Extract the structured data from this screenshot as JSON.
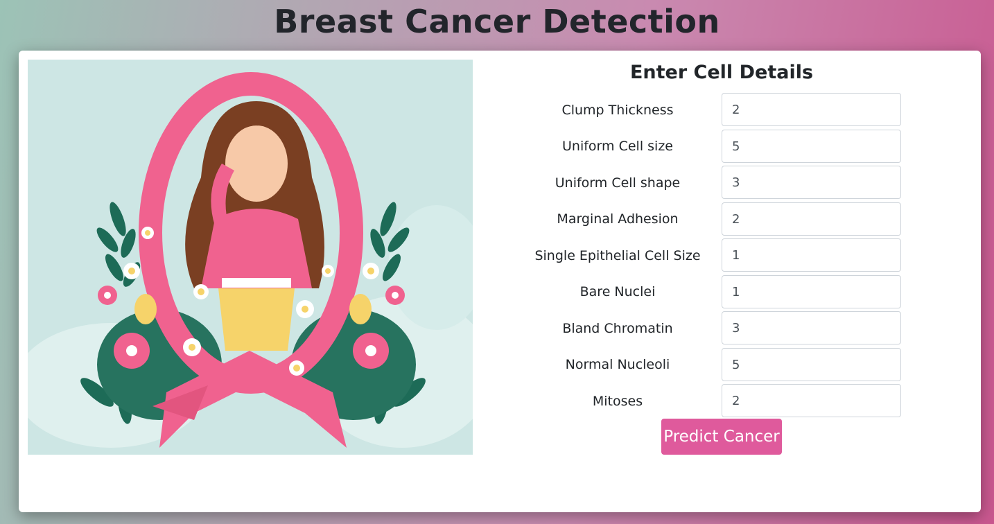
{
  "page": {
    "title": "Breast Cancer Detection"
  },
  "form": {
    "heading": "Enter Cell Details",
    "fields": [
      {
        "label": "Clump Thickness",
        "value": "2"
      },
      {
        "label": "Uniform Cell size",
        "value": "5"
      },
      {
        "label": "Uniform Cell shape",
        "value": "3"
      },
      {
        "label": "Marginal Adhesion",
        "value": "2"
      },
      {
        "label": "Single Epithelial Cell Size",
        "value": "1"
      },
      {
        "label": "Bare Nuclei",
        "value": "1"
      },
      {
        "label": "Bland Chromatin",
        "value": "3"
      },
      {
        "label": "Normal Nucleoli",
        "value": "5"
      },
      {
        "label": "Mitoses",
        "value": "2"
      }
    ],
    "submit_label": "Predict Cancer"
  },
  "colors": {
    "accent": "#df5a9c",
    "ribbon": "#f0628f",
    "illustration_bg": "#cde6e4",
    "title_text": "#22252b"
  },
  "icons": {
    "illustration": "pink-ribbon-woman-illustration"
  }
}
